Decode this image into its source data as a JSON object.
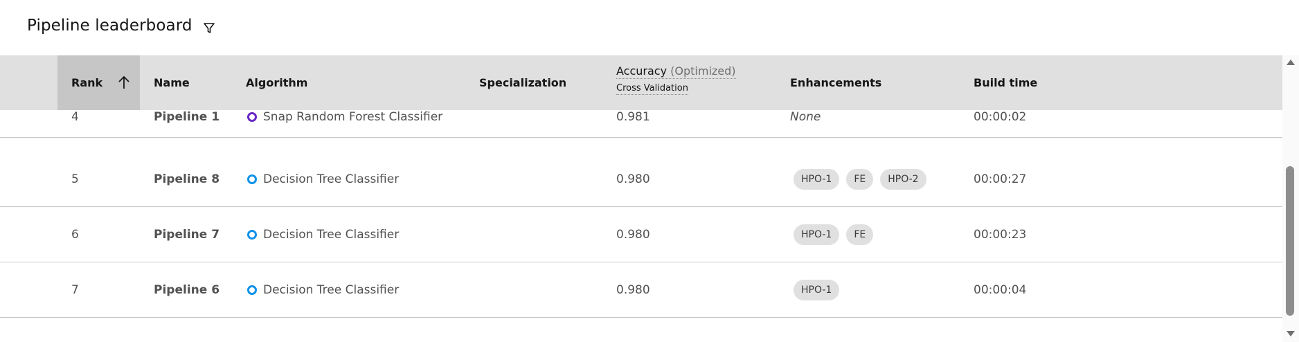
{
  "header": {
    "title": "Pipeline leaderboard",
    "filter_icon": "filter-icon"
  },
  "table": {
    "columns": {
      "rank": "Rank",
      "name": "Name",
      "algorithm": "Algorithm",
      "specialization": "Specialization",
      "accuracy": "Accuracy",
      "accuracy_optimized": "(Optimized)",
      "accuracy_sub": "Cross Validation",
      "enhancements": "Enhancements",
      "build_time": "Build time"
    },
    "sort_icon": "arrow-up-icon",
    "rows": [
      {
        "rank": "4",
        "name": "Pipeline 1",
        "algorithm": "Snap Random Forest Classifier",
        "algo_color": "#6929c4",
        "specialization": "",
        "accuracy": "0.981",
        "enhancements_none": "None",
        "tags": [],
        "build_time": "00:00:02"
      },
      {
        "rank": "5",
        "name": "Pipeline 8",
        "algorithm": "Decision Tree Classifier",
        "algo_color": "#1192e8",
        "specialization": "",
        "accuracy": "0.980",
        "enhancements_none": "",
        "tags": [
          "HPO-1",
          "FE",
          "HPO-2"
        ],
        "build_time": "00:00:27"
      },
      {
        "rank": "6",
        "name": "Pipeline 7",
        "algorithm": "Decision Tree Classifier",
        "algo_color": "#1192e8",
        "specialization": "",
        "accuracy": "0.980",
        "enhancements_none": "",
        "tags": [
          "HPO-1",
          "FE"
        ],
        "build_time": "00:00:23"
      },
      {
        "rank": "7",
        "name": "Pipeline 6",
        "algorithm": "Decision Tree Classifier",
        "algo_color": "#1192e8",
        "specialization": "",
        "accuracy": "0.980",
        "enhancements_none": "",
        "tags": [
          "HPO-1"
        ],
        "build_time": "00:00:04"
      }
    ]
  }
}
